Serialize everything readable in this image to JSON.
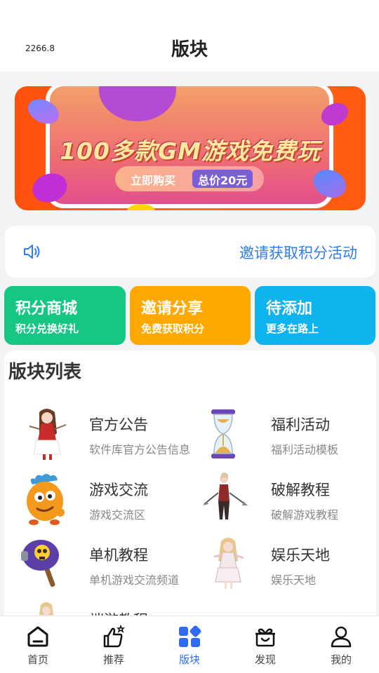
{
  "header": {
    "version": "2266.8",
    "title": "版块"
  },
  "banner": {
    "headline": "100多款GM游戏免费玩",
    "buy_label": "立即购买",
    "price_label": "总价20元"
  },
  "notice": {
    "icon": "speaker-icon",
    "text": "邀请获取积分活动"
  },
  "cards": [
    {
      "title": "积分商城",
      "subtitle": "积分兑换好礼",
      "color": "#16c784"
    },
    {
      "title": "邀请分享",
      "subtitle": "免费获取积分",
      "color": "#ffa800"
    },
    {
      "title": "待添加",
      "subtitle": "更多在路上",
      "color": "#0fb3ee"
    }
  ],
  "boards": {
    "heading": "版块列表",
    "items": [
      {
        "name": "官方公告",
        "desc": "软件库官方公告信息",
        "icon": "anime-girl-avatar"
      },
      {
        "name": "福利活动",
        "desc": "福利活动模板",
        "icon": "hourglass-icon"
      },
      {
        "name": "游戏交流",
        "desc": "游戏交流区",
        "icon": "orange-monster-avatar"
      },
      {
        "name": "破解教程",
        "desc": "破解游戏教程",
        "icon": "warrior-avatar"
      },
      {
        "name": "单机教程",
        "desc": "单机游戏交流频道",
        "icon": "skull-hammer-icon"
      },
      {
        "name": "娱乐天地",
        "desc": "娱乐天地",
        "icon": "fairy-avatar"
      },
      {
        "name": "端游教程",
        "desc": "",
        "icon": "character-avatar"
      }
    ]
  },
  "tabbar": {
    "active_color": "#2f6bf2",
    "items": [
      {
        "label": "首页",
        "icon": "home-icon"
      },
      {
        "label": "推荐",
        "icon": "thumbs-up-icon"
      },
      {
        "label": "版块",
        "icon": "grid-icon",
        "active": true
      },
      {
        "label": "发现",
        "icon": "gift-icon"
      },
      {
        "label": "我的",
        "icon": "user-icon"
      }
    ]
  }
}
